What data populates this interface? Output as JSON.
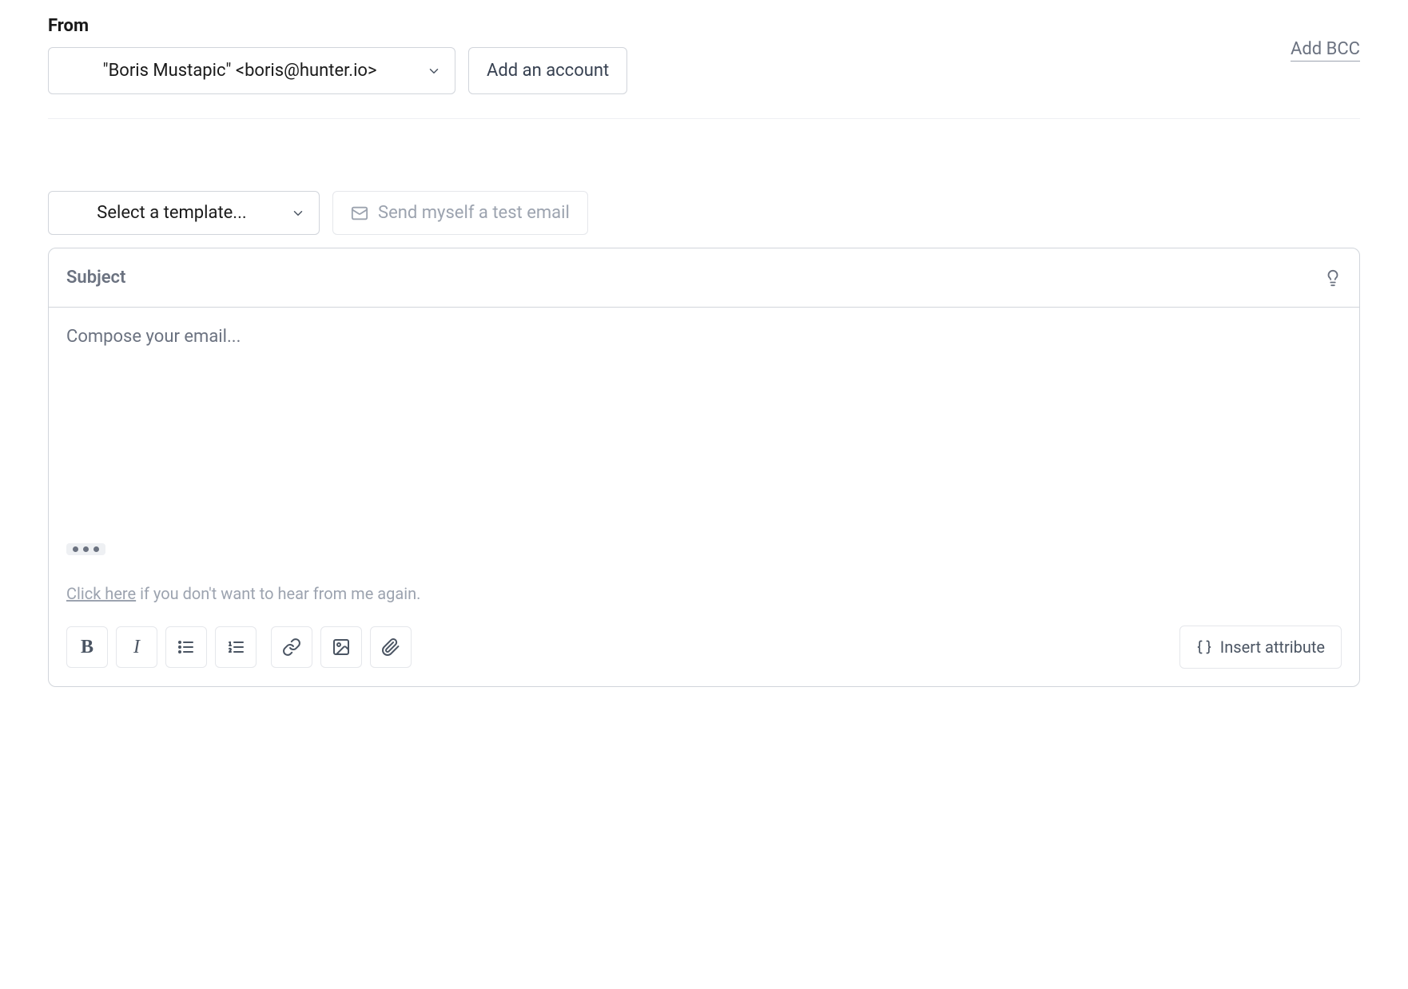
{
  "from": {
    "label": "From",
    "selected": "\"Boris Mustapic\" <boris@hunter.io>",
    "add_account_label": "Add an account",
    "add_bcc_label": "Add BCC"
  },
  "template": {
    "placeholder": "Select a template...",
    "test_email_label": "Send myself a test email"
  },
  "compose": {
    "subject_placeholder": "Subject",
    "body_placeholder": "Compose your email...",
    "unsub_link_text": "Click here",
    "unsub_rest": " if you don't want to hear from me again."
  },
  "toolbar": {
    "insert_attribute_label": "Insert attribute"
  }
}
